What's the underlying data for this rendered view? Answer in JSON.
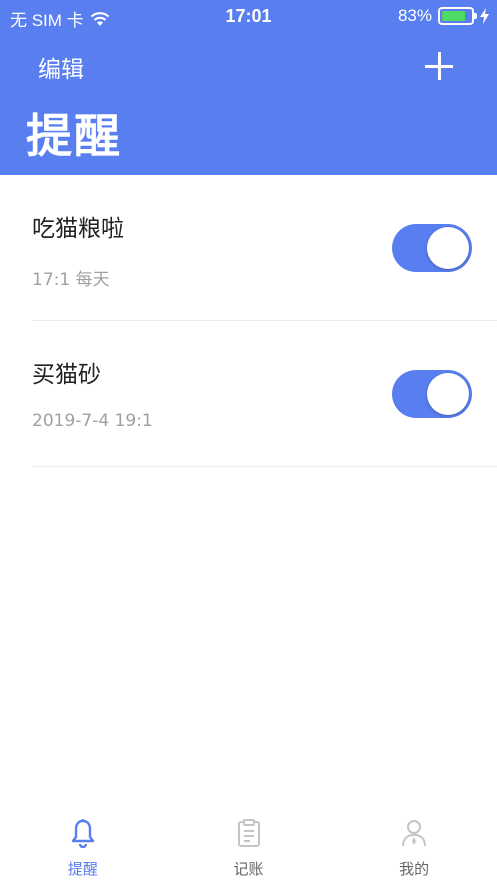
{
  "status_bar": {
    "carrier": "无 SIM 卡",
    "time": "17:01",
    "battery": "83%",
    "battery_level": 0.83
  },
  "nav": {
    "edit_label": "编辑",
    "add_icon": "plus-icon",
    "title": "提醒"
  },
  "reminders": [
    {
      "title": "吃猫粮啦",
      "schedule": "17:1  每天",
      "enabled": true
    },
    {
      "title": "买猫砂",
      "schedule": "2019-7-4  19:1",
      "enabled": true
    }
  ],
  "tabbar": {
    "items": [
      {
        "label": "提醒",
        "icon": "bell-icon",
        "active": true
      },
      {
        "label": "记账",
        "icon": "clipboard-icon",
        "active": false
      },
      {
        "label": "我的",
        "icon": "person-icon",
        "active": false
      }
    ]
  },
  "colors": {
    "accent": "#597ef0",
    "battery": "#4cd964",
    "subtitle": "#a0a0a0"
  }
}
